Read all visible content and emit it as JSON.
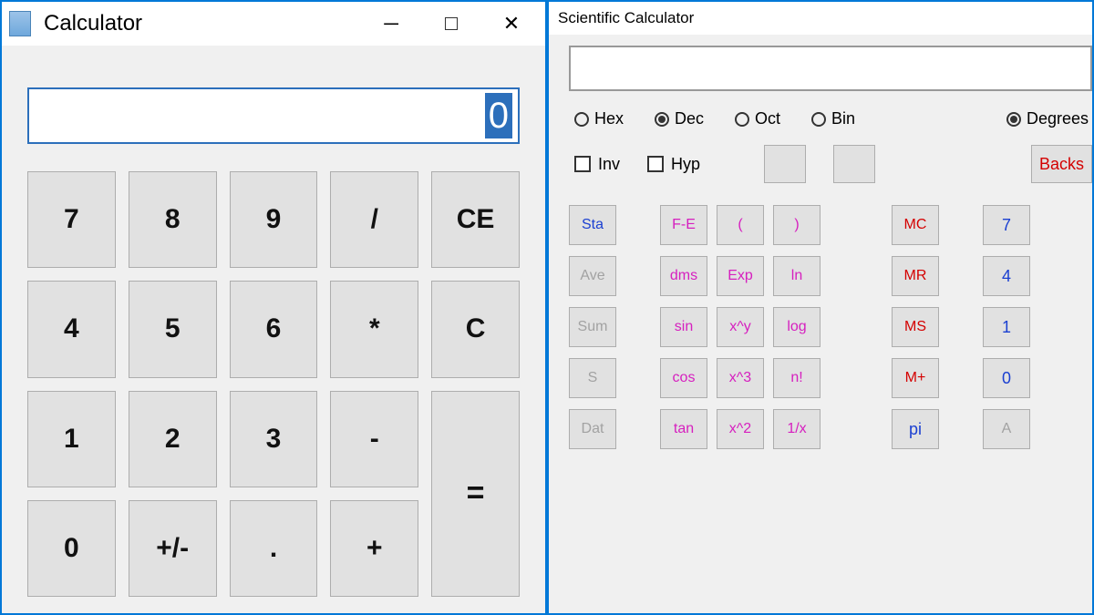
{
  "basic": {
    "title": "Calculator",
    "display": "0",
    "buttons": {
      "b7": "7",
      "b8": "8",
      "b9": "9",
      "div": "/",
      "ce": "CE",
      "b4": "4",
      "b5": "5",
      "b6": "6",
      "mul": "*",
      "c": "C",
      "b1": "1",
      "b2": "2",
      "b3": "3",
      "sub": "-",
      "eq": "=",
      "b0": "0",
      "neg": "+/-",
      "dec": ".",
      "add": "+"
    }
  },
  "sci": {
    "title": "Scientific Calculator",
    "radios": {
      "hex": "Hex",
      "dec": "Dec",
      "oct": "Oct",
      "bin": "Bin",
      "degrees": "Degrees",
      "selected_base": "dec",
      "selected_angle": "degrees"
    },
    "checks": {
      "inv": "Inv",
      "hyp": "Hyp"
    },
    "backspace": "Backs",
    "rows": [
      {
        "stat": {
          "label": "Sta",
          "state": "active"
        },
        "f": [
          "F-E",
          "(",
          ")"
        ],
        "mem": "MC",
        "num": "7"
      },
      {
        "stat": {
          "label": "Ave",
          "state": "dis"
        },
        "f": [
          "dms",
          "Exp",
          "ln"
        ],
        "mem": "MR",
        "num": "4"
      },
      {
        "stat": {
          "label": "Sum",
          "state": "dis"
        },
        "f": [
          "sin",
          "x^y",
          "log"
        ],
        "mem": "MS",
        "num": "1"
      },
      {
        "stat": {
          "label": "S",
          "state": "dis"
        },
        "f": [
          "cos",
          "x^3",
          "n!"
        ],
        "mem": "M+",
        "num": "0"
      },
      {
        "stat": {
          "label": "Dat",
          "state": "dis"
        },
        "f": [
          "tan",
          "x^2",
          "1/x"
        ],
        "mem": "pi",
        "mem_color": "num",
        "num": "A",
        "num_color": "dis"
      }
    ]
  }
}
